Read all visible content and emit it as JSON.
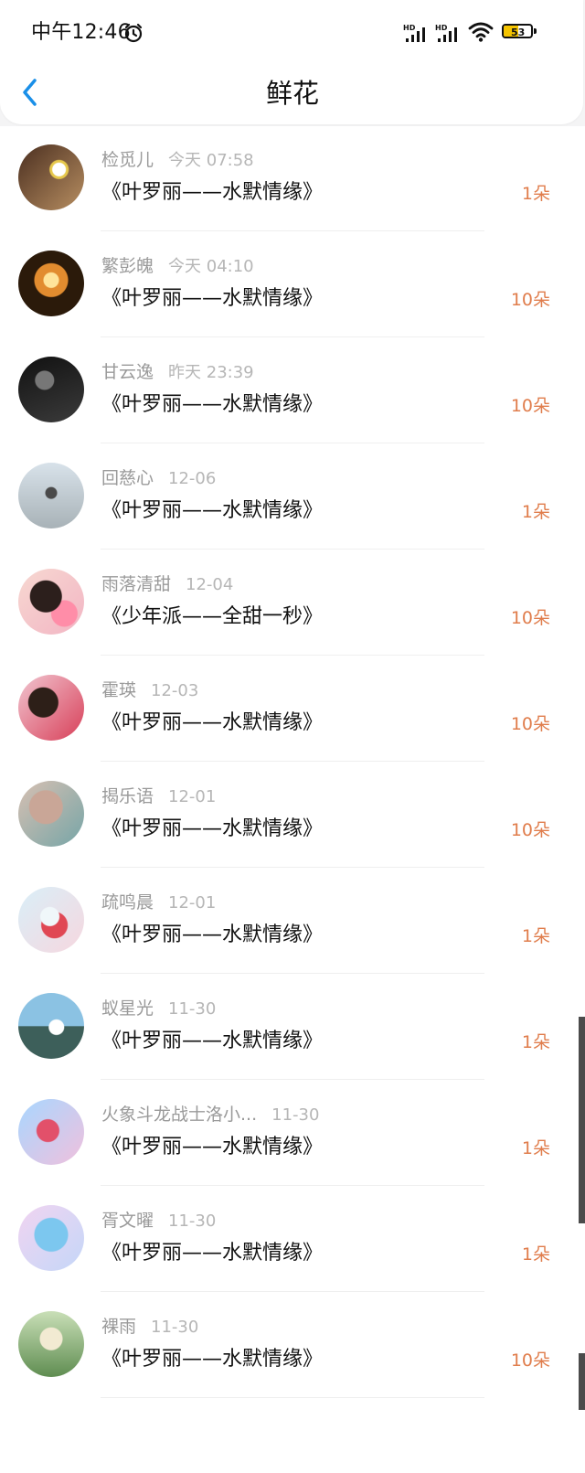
{
  "status_bar": {
    "time": "中午12:46",
    "battery_level": "53",
    "signal_label_1": "HD",
    "signal_label_2": "HD"
  },
  "header": {
    "title": "鲜花"
  },
  "flowers": [
    {
      "name": "检觅儿",
      "time": "今天 07:58",
      "message": "《叶罗丽——水默情缘》",
      "count": "1朵"
    },
    {
      "name": "繁彭魄",
      "time": "今天 04:10",
      "message": "《叶罗丽——水默情缘》",
      "count": "10朵"
    },
    {
      "name": "甘云逸",
      "time": "昨天 23:39",
      "message": "《叶罗丽——水默情缘》",
      "count": "10朵"
    },
    {
      "name": "回慈心",
      "time": "12-06",
      "message": "《叶罗丽——水默情缘》",
      "count": "1朵"
    },
    {
      "name": "雨落清甜",
      "time": "12-04",
      "message": "《少年派——全甜一秒》",
      "count": "10朵"
    },
    {
      "name": "霍瑛",
      "time": "12-03",
      "message": "《叶罗丽——水默情缘》",
      "count": "10朵"
    },
    {
      "name": "揭乐语",
      "time": "12-01",
      "message": "《叶罗丽——水默情缘》",
      "count": "10朵"
    },
    {
      "name": "疏鸣晨",
      "time": "12-01",
      "message": "《叶罗丽——水默情缘》",
      "count": "1朵"
    },
    {
      "name": "蚁星光",
      "time": "11-30",
      "message": "《叶罗丽——水默情缘》",
      "count": "1朵"
    },
    {
      "name": "火象斗龙战士洛小...",
      "time": "11-30",
      "message": "《叶罗丽——水默情缘》",
      "count": "1朵"
    },
    {
      "name": "胥文曜",
      "time": "11-30",
      "message": "《叶罗丽——水默情缘》",
      "count": "1朵"
    },
    {
      "name": "裸雨",
      "time": "11-30",
      "message": "《叶罗丽——水默情缘》",
      "count": "10朵"
    }
  ],
  "colors": {
    "accent": "#1a8fe8",
    "count": "#e07d4c",
    "meta": "#9a9a9a"
  },
  "icons": {
    "back": "chevron-left-icon",
    "alarm": "alarm-clock-icon",
    "signal": "cell-signal-icon",
    "wifi": "wifi-icon"
  }
}
